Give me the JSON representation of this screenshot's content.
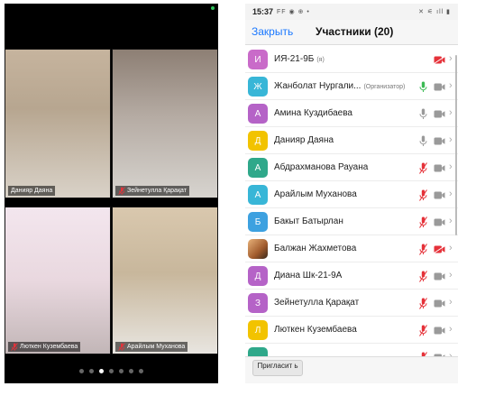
{
  "video_grid": {
    "tiles": [
      {
        "name": "Данияр Даяна",
        "muted": false
      },
      {
        "name": "Зейнетулла Қарақат",
        "muted": true
      },
      {
        "name": "Люткен Кузембаева",
        "muted": true
      },
      {
        "name": "Арайлым Муханова",
        "muted": true
      }
    ],
    "page_count": 7,
    "active_page": 3
  },
  "phone": {
    "status_time": "15:37",
    "status_left_icons": "FF ◉ ⊕ •",
    "status_right_icons": "✕ ⚟ ıll ▮",
    "nav_left": "Закрыть",
    "nav_title": "Участники (20)",
    "invite_label": "Пригласит ь"
  },
  "participants": [
    {
      "initial": "И",
      "color": "#c96bc9",
      "name": "ИЯ-21-9Б",
      "tag": "(я)",
      "mic": "none",
      "cam": "off"
    },
    {
      "initial": "Ж",
      "color": "#38b6d7",
      "name": "Жанболат Нургали...",
      "tag": "(Организатор)",
      "mic": "on",
      "cam": "on"
    },
    {
      "initial": "А",
      "color": "#b563c7",
      "name": "Амина Куздибаева",
      "tag": "",
      "mic": "gray",
      "cam": "on"
    },
    {
      "initial": "Д",
      "color": "#f2c300",
      "name": "Данияр Даяна",
      "tag": "",
      "mic": "gray",
      "cam": "on"
    },
    {
      "initial": "А",
      "color": "#2fa88a",
      "name": "Абдрахманова Рауана",
      "tag": "",
      "mic": "muted",
      "cam": "on"
    },
    {
      "initial": "А",
      "color": "#38b6d7",
      "name": "Арайлым Муханова",
      "tag": "",
      "mic": "muted",
      "cam": "on"
    },
    {
      "initial": "Б",
      "color": "#3da1e0",
      "name": "Бакыт Батырлан",
      "tag": "",
      "mic": "muted",
      "cam": "on"
    },
    {
      "initial": "",
      "color": "#d8a060",
      "name": "Балжан Жахметова",
      "tag": "",
      "mic": "muted",
      "cam": "off",
      "photo": true
    },
    {
      "initial": "Д",
      "color": "#b563c7",
      "name": "Диана Шк-21-9А",
      "tag": "",
      "mic": "muted",
      "cam": "on"
    },
    {
      "initial": "З",
      "color": "#b563c7",
      "name": "Зейнетулла Қарақат",
      "tag": "",
      "mic": "muted",
      "cam": "on"
    },
    {
      "initial": "Л",
      "color": "#f2c300",
      "name": "Люткен Кузембаева",
      "tag": "",
      "mic": "muted",
      "cam": "on"
    },
    {
      "initial": "",
      "color": "#2fa88a",
      "name": "",
      "tag": "",
      "mic": "muted",
      "cam": "on"
    }
  ],
  "colors": {
    "accent": "#1b78ff",
    "muted_red": "#e5323a",
    "mic_green": "#3cba54"
  },
  "icons": {
    "mic": "microphone-icon",
    "mic_muted": "microphone-muted-icon",
    "camera": "camera-icon",
    "camera_off": "camera-off-icon",
    "chevron": "chevron-right-icon"
  }
}
